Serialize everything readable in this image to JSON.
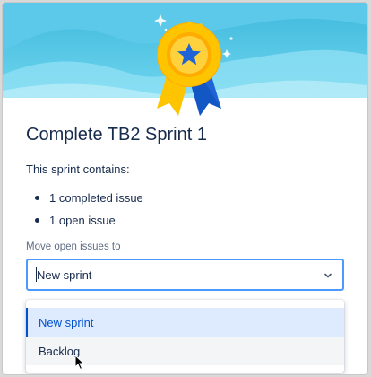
{
  "dialog": {
    "title": "Complete TB2 Sprint 1",
    "intro": "This sprint contains:",
    "issues": [
      {
        "text": "1 completed issue"
      },
      {
        "text": "1 open issue"
      }
    ],
    "move_label": "Move open issues to",
    "select": {
      "value": "New sprint",
      "options": [
        {
          "label": "New sprint",
          "state": "selected"
        },
        {
          "label": "Backlog",
          "state": "hovered"
        }
      ]
    },
    "header_icon": "award-ribbon-star-icon"
  },
  "colors": {
    "header_sky": "#4fc9e8",
    "badge_gold": "#ffc400",
    "badge_star": "#1e64d6",
    "focus_border": "#4c9aff",
    "selected_bg": "#deebff",
    "selected_text": "#0052cc"
  }
}
